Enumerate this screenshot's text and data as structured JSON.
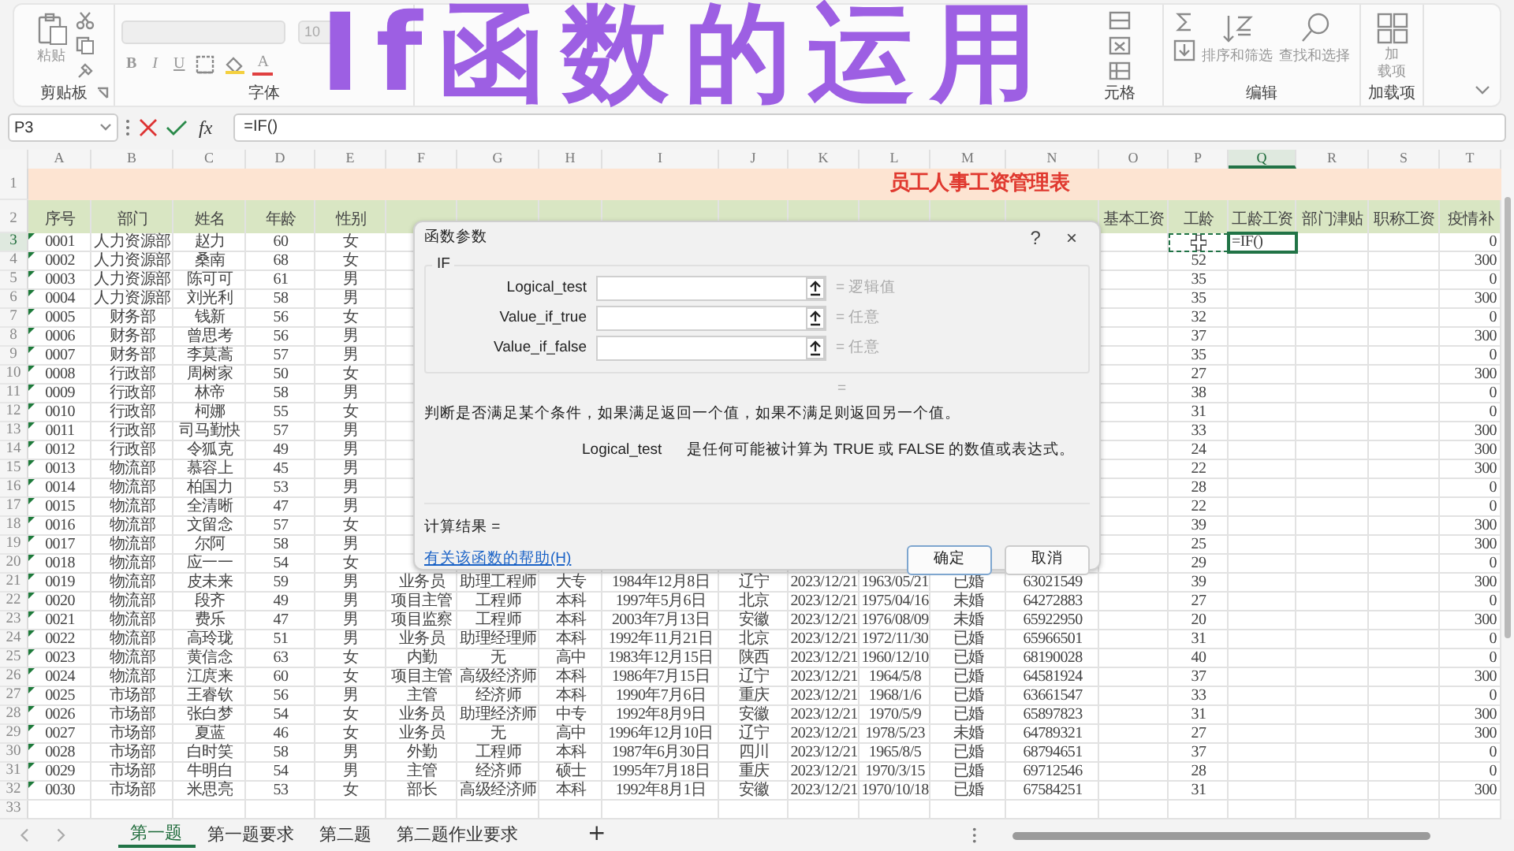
{
  "overlay_title": "If函数的运用",
  "ribbon": {
    "groups": [
      {
        "kind": "clipboard",
        "label": "剪贴板",
        "items": [
          {
            "kind": "paste",
            "label": "粘贴"
          },
          {
            "kind": "cut"
          },
          {
            "kind": "copy"
          },
          {
            "kind": "painter"
          }
        ]
      },
      {
        "kind": "font",
        "label": "字体",
        "items": [
          {
            "kind": "font-name"
          },
          {
            "kind": "font-size",
            "value": "10"
          },
          {
            "kind": "bold",
            "label": "B"
          },
          {
            "kind": "italic",
            "label": "I"
          },
          {
            "kind": "underline",
            "label": "U"
          },
          {
            "kind": "border"
          },
          {
            "kind": "fill"
          },
          {
            "kind": "font-color",
            "label": "A"
          }
        ]
      },
      {
        "kind": "cells",
        "label": "元格",
        "items": [
          {
            "kind": "insert"
          },
          {
            "kind": "delete"
          },
          {
            "kind": "format"
          }
        ]
      },
      {
        "kind": "editing",
        "label": "编辑",
        "items": [
          {
            "kind": "sum"
          },
          {
            "kind": "fill-down"
          },
          {
            "kind": "sort",
            "label": "排序和筛选"
          },
          {
            "kind": "find",
            "label": "查找和选择"
          }
        ]
      },
      {
        "kind": "addins",
        "label": "加载项",
        "items": [
          {
            "kind": "addins",
            "lines": [
              "加",
              "载项"
            ]
          }
        ]
      }
    ]
  },
  "formula_bar": {
    "name_box": "P3",
    "fx": "fx",
    "formula": "=IF()"
  },
  "grid": {
    "columns": [
      {
        "label": "A",
        "selected": false
      },
      {
        "label": "B",
        "selected": false
      },
      {
        "label": "C",
        "selected": false
      },
      {
        "label": "D",
        "selected": false
      },
      {
        "label": "E",
        "selected": false
      },
      {
        "label": "F",
        "selected": false
      },
      {
        "label": "G",
        "selected": false
      },
      {
        "label": "H",
        "selected": false
      },
      {
        "label": "I",
        "selected": false
      },
      {
        "label": "J",
        "selected": false
      },
      {
        "label": "K",
        "selected": false
      },
      {
        "label": "L",
        "selected": false
      },
      {
        "label": "M",
        "selected": false
      },
      {
        "label": "N",
        "selected": false
      },
      {
        "label": "O",
        "selected": false
      },
      {
        "label": "P",
        "selected": false
      },
      {
        "label": "Q",
        "selected": true
      },
      {
        "label": "R",
        "selected": false
      },
      {
        "label": "S",
        "selected": false
      },
      {
        "label": "T",
        "selected": false
      }
    ],
    "rows": [
      {
        "label": "1",
        "kind": "title",
        "selected": false,
        "title": "员工人事工资管理表"
      },
      {
        "label": "2",
        "kind": "header",
        "selected": false,
        "cells": {
          "A": "序号",
          "B": "部门",
          "C": "姓名",
          "D": "年龄",
          "E": "性别",
          "O": "基本工资",
          "P": "工龄",
          "Q": "工龄工资",
          "R": "部门津贴",
          "S": "职称工资",
          "T": "疫情补"
        }
      },
      {
        "label": "3",
        "kind": "data",
        "selected": true,
        "flag": true,
        "cells": {
          "A": "0001",
          "B": "人力资源部",
          "C": "赵力",
          "D": "60",
          "E": "女",
          "P": {
            "referenced": true
          },
          "Q": "=IF()",
          "T": "0"
        }
      },
      {
        "label": "4",
        "kind": "data",
        "selected": false,
        "flag": true,
        "cells": {
          "A": "0002",
          "B": "人力资源部",
          "C": "桑南",
          "D": "68",
          "E": "女",
          "P": "52",
          "T": "300"
        }
      },
      {
        "label": "5",
        "kind": "data",
        "selected": false,
        "flag": true,
        "cells": {
          "A": "0003",
          "B": "人力资源部",
          "C": "陈可可",
          "D": "61",
          "E": "男",
          "P": "35",
          "T": "0"
        }
      },
      {
        "label": "6",
        "kind": "data",
        "selected": false,
        "flag": true,
        "cells": {
          "A": "0004",
          "B": "人力资源部",
          "C": "刘光利",
          "D": "58",
          "E": "男",
          "P": "35",
          "T": "300"
        }
      },
      {
        "label": "7",
        "kind": "data",
        "selected": false,
        "flag": true,
        "cells": {
          "A": "0005",
          "B": "财务部",
          "C": "钱新",
          "D": "56",
          "E": "女",
          "P": "32",
          "T": "0"
        }
      },
      {
        "label": "8",
        "kind": "data",
        "selected": false,
        "flag": true,
        "cells": {
          "A": "0006",
          "B": "财务部",
          "C": "曾思考",
          "D": "56",
          "E": "男",
          "P": "37",
          "T": "300"
        }
      },
      {
        "label": "9",
        "kind": "data",
        "selected": false,
        "flag": true,
        "cells": {
          "A": "0007",
          "B": "财务部",
          "C": "李莫蒿",
          "D": "57",
          "E": "男",
          "P": "35",
          "T": "0"
        }
      },
      {
        "label": "10",
        "kind": "data",
        "selected": false,
        "flag": true,
        "cells": {
          "A": "0008",
          "B": "行政部",
          "C": "周树家",
          "D": "50",
          "E": "女",
          "P": "27",
          "T": "300"
        }
      },
      {
        "label": "11",
        "kind": "data",
        "selected": false,
        "flag": true,
        "cells": {
          "A": "0009",
          "B": "行政部",
          "C": "林帝",
          "D": "58",
          "E": "男",
          "P": "38",
          "T": "0"
        }
      },
      {
        "label": "12",
        "kind": "data",
        "selected": false,
        "flag": true,
        "cells": {
          "A": "0010",
          "B": "行政部",
          "C": "柯娜",
          "D": "55",
          "E": "女",
          "P": "31",
          "T": "0"
        }
      },
      {
        "label": "13",
        "kind": "data",
        "selected": false,
        "flag": true,
        "cells": {
          "A": "0011",
          "B": "行政部",
          "C": "司马勤快",
          "D": "57",
          "E": "男",
          "P": "33",
          "T": "300"
        }
      },
      {
        "label": "14",
        "kind": "data",
        "selected": false,
        "flag": true,
        "cells": {
          "A": "0012",
          "B": "行政部",
          "C": "令狐克",
          "D": "49",
          "E": "男",
          "P": "24",
          "T": "300"
        }
      },
      {
        "label": "15",
        "kind": "data",
        "selected": false,
        "flag": true,
        "cells": {
          "A": "0013",
          "B": "物流部",
          "C": "慕容上",
          "D": "45",
          "E": "男",
          "P": "22",
          "T": "300"
        }
      },
      {
        "label": "16",
        "kind": "data",
        "selected": false,
        "flag": true,
        "cells": {
          "A": "0014",
          "B": "物流部",
          "C": "柏国力",
          "D": "53",
          "E": "男",
          "P": "28",
          "T": "0"
        }
      },
      {
        "label": "17",
        "kind": "data",
        "selected": false,
        "flag": true,
        "cells": {
          "A": "0015",
          "B": "物流部",
          "C": "全清晰",
          "D": "47",
          "E": "男",
          "P": "22",
          "T": "0"
        }
      },
      {
        "label": "18",
        "kind": "data",
        "selected": false,
        "flag": true,
        "cells": {
          "A": "0016",
          "B": "物流部",
          "C": "文留念",
          "D": "57",
          "E": "女",
          "P": "39",
          "T": "300"
        }
      },
      {
        "label": "19",
        "kind": "data",
        "selected": false,
        "flag": true,
        "cells": {
          "A": "0017",
          "B": "物流部",
          "C": "尔阿",
          "D": "58",
          "E": "男",
          "P": "25",
          "T": "300"
        }
      },
      {
        "label": "20",
        "kind": "data",
        "selected": false,
        "flag": true,
        "cells": {
          "A": "0018",
          "B": "物流部",
          "C": "应一一",
          "D": "54",
          "E": "女",
          "P": "29",
          "T": "0"
        }
      },
      {
        "label": "21",
        "kind": "data",
        "selected": false,
        "flag": true,
        "cells": {
          "A": "0019",
          "B": "物流部",
          "C": "皮未来",
          "D": "59",
          "E": "男",
          "F": "业务员",
          "G": "助理工程师",
          "H": "大专",
          "I": "1984年12月8日",
          "J": "辽宁",
          "K": "2023/12/21",
          "L": "1963/05/21",
          "M": "已婚",
          "N": "63021549",
          "P": "39",
          "T": "300"
        }
      },
      {
        "label": "22",
        "kind": "data",
        "selected": false,
        "flag": true,
        "cells": {
          "A": "0020",
          "B": "物流部",
          "C": "段齐",
          "D": "49",
          "E": "男",
          "F": "项目主管",
          "G": "工程师",
          "H": "本科",
          "I": "1997年5月6日",
          "J": "北京",
          "K": "2023/12/21",
          "L": "1975/04/16",
          "M": "未婚",
          "N": "64272883",
          "P": "27",
          "T": "0"
        }
      },
      {
        "label": "23",
        "kind": "data",
        "selected": false,
        "flag": true,
        "cells": {
          "A": "0021",
          "B": "物流部",
          "C": "费乐",
          "D": "47",
          "E": "男",
          "F": "项目监察",
          "G": "工程师",
          "H": "本科",
          "I": "2003年7月13日",
          "J": "安徽",
          "K": "2023/12/21",
          "L": "1976/08/09",
          "M": "未婚",
          "N": "65922950",
          "P": "20",
          "T": "300"
        }
      },
      {
        "label": "24",
        "kind": "data",
        "selected": false,
        "flag": true,
        "cells": {
          "A": "0022",
          "B": "物流部",
          "C": "高玲珑",
          "D": "51",
          "E": "男",
          "F": "业务员",
          "G": "助理经理师",
          "H": "本科",
          "I": "1992年11月21日",
          "J": "北京",
          "K": "2023/12/21",
          "L": "1972/11/30",
          "M": "已婚",
          "N": "65966501",
          "P": "31",
          "T": "0"
        }
      },
      {
        "label": "25",
        "kind": "data",
        "selected": false,
        "flag": true,
        "cells": {
          "A": "0023",
          "B": "物流部",
          "C": "黄信念",
          "D": "63",
          "E": "女",
          "F": "内勤",
          "G": "无",
          "H": "高中",
          "I": "1983年12月15日",
          "J": "陕西",
          "K": "2023/12/21",
          "L": "1960/12/10",
          "M": "已婚",
          "N": "68190028",
          "P": "40",
          "T": "0"
        }
      },
      {
        "label": "26",
        "kind": "data",
        "selected": false,
        "flag": true,
        "cells": {
          "A": "0024",
          "B": "物流部",
          "C": "江庹来",
          "D": "60",
          "E": "女",
          "F": "项目主管",
          "G": "高级经济师",
          "H": "本科",
          "I": "1986年7月15日",
          "J": "辽宁",
          "K": "2023/12/21",
          "L": "1964/5/8",
          "M": "已婚",
          "N": "64581924",
          "P": "37",
          "T": "300"
        }
      },
      {
        "label": "27",
        "kind": "data",
        "selected": false,
        "flag": true,
        "cells": {
          "A": "0025",
          "B": "市场部",
          "C": "王睿钦",
          "D": "56",
          "E": "男",
          "F": "主管",
          "G": "经济师",
          "H": "本科",
          "I": "1990年7月6日",
          "J": "重庆",
          "K": "2023/12/21",
          "L": "1968/1/6",
          "M": "已婚",
          "N": "63661547",
          "P": "33",
          "T": "0"
        }
      },
      {
        "label": "28",
        "kind": "data",
        "selected": false,
        "flag": true,
        "cells": {
          "A": "0026",
          "B": "市场部",
          "C": "张白梦",
          "D": "54",
          "E": "女",
          "F": "业务员",
          "G": "助理经济师",
          "H": "中专",
          "I": "1992年8月9日",
          "J": "安徽",
          "K": "2023/12/21",
          "L": "1970/5/9",
          "M": "已婚",
          "N": "65897823",
          "P": "31",
          "T": "300"
        }
      },
      {
        "label": "29",
        "kind": "data",
        "selected": false,
        "flag": true,
        "cells": {
          "A": "0027",
          "B": "市场部",
          "C": "夏蓝",
          "D": "46",
          "E": "女",
          "F": "业务员",
          "G": "无",
          "H": "高中",
          "I": "1996年12月10日",
          "J": "辽宁",
          "K": "2023/12/21",
          "L": "1978/5/23",
          "M": "未婚",
          "N": "64789321",
          "P": "27",
          "T": "300"
        }
      },
      {
        "label": "30",
        "kind": "data",
        "selected": false,
        "flag": true,
        "cells": {
          "A": "0028",
          "B": "市场部",
          "C": "白时笑",
          "D": "58",
          "E": "男",
          "F": "外勤",
          "G": "工程师",
          "H": "本科",
          "I": "1987年6月30日",
          "J": "四川",
          "K": "2023/12/21",
          "L": "1965/8/5",
          "M": "已婚",
          "N": "68794651",
          "P": "37",
          "T": "0"
        }
      },
      {
        "label": "31",
        "kind": "data",
        "selected": false,
        "flag": true,
        "cells": {
          "A": "0029",
          "B": "市场部",
          "C": "牛明白",
          "D": "54",
          "E": "男",
          "F": "主管",
          "G": "经济师",
          "H": "硕士",
          "I": "1995年7月18日",
          "J": "重庆",
          "K": "2023/12/21",
          "L": "1970/3/15",
          "M": "已婚",
          "N": "69712546",
          "P": "28",
          "T": "0"
        }
      },
      {
        "label": "32",
        "kind": "data",
        "selected": false,
        "flag": true,
        "cells": {
          "A": "0030",
          "B": "市场部",
          "C": "米思亮",
          "D": "53",
          "E": "女",
          "F": "部长",
          "G": "高级经济师",
          "H": "本科",
          "I": "1992年8月1日",
          "J": "安徽",
          "K": "2023/12/21",
          "L": "1970/10/18",
          "M": "已婚",
          "N": "67584251",
          "P": "31",
          "T": "300"
        }
      },
      {
        "label": "33",
        "kind": "data",
        "selected": false,
        "flag": false,
        "cells": {}
      }
    ]
  },
  "dialog": {
    "title": "函数参数",
    "help_glyph": "?",
    "close_glyph": "×",
    "function": "IF",
    "arguments": [
      {
        "label": "Logical_test",
        "hint": "=  逻辑值"
      },
      {
        "label": "Value_if_true",
        "hint": "=  任意"
      },
      {
        "label": "Value_if_false",
        "hint": "=  任意"
      }
    ],
    "result_equals": "=",
    "description": "判断是否满足某个条件，如果满足返回一个值，如果不满足则返回另一个值。",
    "argument_help": {
      "name": "Logical_test",
      "text": "是任何可能被计算为 TRUE 或 FALSE 的数值或表达式。"
    },
    "result_label": "计算结果 =",
    "help_link": "有关该函数的帮助(H)",
    "buttons": [
      {
        "label": "确定",
        "default": true
      },
      {
        "label": "取消",
        "default": false
      }
    ]
  },
  "sheet_tabs": [
    {
      "label": "第一题",
      "selected": true
    },
    {
      "label": "第一题要求",
      "selected": false
    },
    {
      "label": "第二题",
      "selected": false
    },
    {
      "label": "第二题作业要求",
      "selected": false
    }
  ],
  "add_sheet": "+"
}
